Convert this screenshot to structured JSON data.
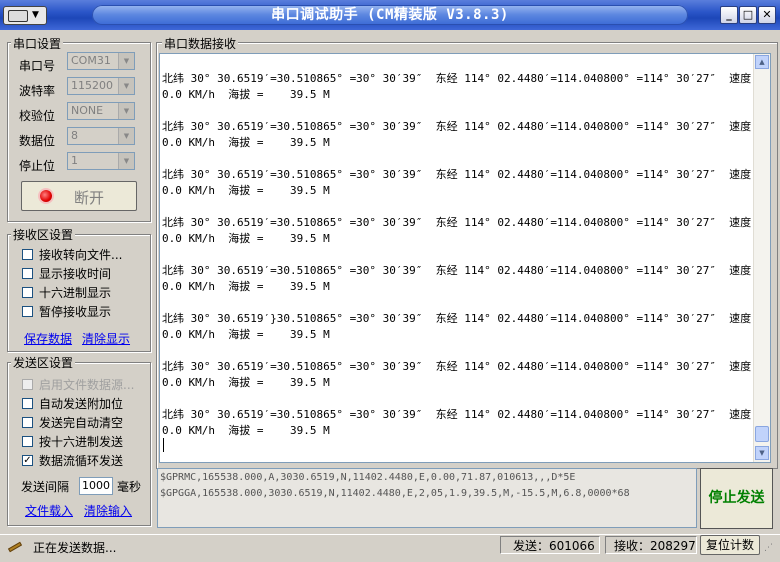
{
  "window": {
    "title": "串口调试助手 (CM精装版 V3.8.3)",
    "sysmenu_icon": "keyboard-icon",
    "min_label": "_",
    "max_label": "□",
    "close_label": "✕"
  },
  "port_settings": {
    "title": "串口设置",
    "fields": [
      {
        "label": "串口号",
        "value": "COM31"
      },
      {
        "label": "波特率",
        "value": "115200"
      },
      {
        "label": "校验位",
        "value": "NONE"
      },
      {
        "label": "数据位",
        "value": "8"
      },
      {
        "label": "停止位",
        "value": "1"
      }
    ],
    "open_button": "断开",
    "status_color": "#e00000"
  },
  "recv_settings": {
    "title": "接收区设置",
    "options": [
      {
        "label": "接收转向文件...",
        "checked": false
      },
      {
        "label": "显示接收时间",
        "checked": false
      },
      {
        "label": "十六进制显示",
        "checked": false
      },
      {
        "label": "暂停接收显示",
        "checked": false
      }
    ],
    "save_link": "保存数据",
    "clear_link": "清除显示"
  },
  "send_settings": {
    "title": "发送区设置",
    "options": [
      {
        "label": "启用文件数据源...",
        "checked": false,
        "disabled": true
      },
      {
        "label": "自动发送附加位",
        "checked": false
      },
      {
        "label": "发送完自动清空",
        "checked": false
      },
      {
        "label": "按十六进制发送",
        "checked": false
      },
      {
        "label": "数据流循环发送",
        "checked": true
      }
    ],
    "interval_label": "发送间隔",
    "interval_value": "1000",
    "interval_unit": "毫秒",
    "load_link": "文件载入",
    "clear_link": "清除输入"
  },
  "recv_area": {
    "title": "串口数据接收",
    "lines": [
      "北纬 30° 30.6519′=30.510865° =30° 30′39″  东经 114° 02.4480′=114.040800° =114° 30′27″  速度 =",
      "0.0 KM/h  海拔 =    39.5 M",
      "北纬 30° 30.6519′=30.510865° =30° 30′39″  东经 114° 02.4480′=114.040800° =114° 30′27″  速度 =",
      "0.0 KM/h  海拔 =    39.5 M",
      "北纬 30° 30.6519′=30.510865° =30° 30′39″  东经 114° 02.4480′=114.040800° =114° 30′27″  速度 =",
      "0.0 KM/h  海拔 =    39.5 M",
      "北纬 30° 30.6519′=30.510865° =30° 30′39″  东经 114° 02.4480′=114.040800° =114° 30′27″  速度 =",
      "0.0 KM/h  海拔 =    39.5 M",
      "北纬 30° 30.6519′=30.510865° =30° 30′39″  东经 114° 02.4480′=114.040800° =114° 30′27″  速度 =",
      "0.0 KM/h  海拔 =    39.5 M",
      "北纬 30° 30.6519′}30.510865° =30° 30′39″  东经 114° 02.4480′=114.040800° =114° 30′27″  速度 =",
      "0.0 KM/h  海拔 =    39.5 M",
      "北纬 30° 30.6519′=30.510865° =30° 30′39″  东经 114° 02.4480′=114.040800° =114° 30′27″  速度 =",
      "0.0 KM/h  海拔 =    39.5 M",
      "北纬 30° 30.6519′=30.510865° =30° 30′39″  东经 114° 02.4480′=114.040800° =114° 30′27″  速度 =",
      "0.0 KM/h  海拔 =    39.5 M"
    ]
  },
  "send_area": {
    "lines": [
      "$GPRMC,165538.000,A,3030.6519,N,11402.4480,E,0.00,71.87,010613,,,D*5E",
      "$GPGGA,165538.000,3030.6519,N,11402.4480,E,2,05,1.9,39.5,M,-15.5,M,6.8,0000*68"
    ],
    "stop_button": "停止发送"
  },
  "status_bar": {
    "status_icon": "pen-icon",
    "status_text": "正在发送数据...",
    "sent": "发送：601066",
    "received": "接收：208297",
    "reset_button": "复位计数"
  }
}
